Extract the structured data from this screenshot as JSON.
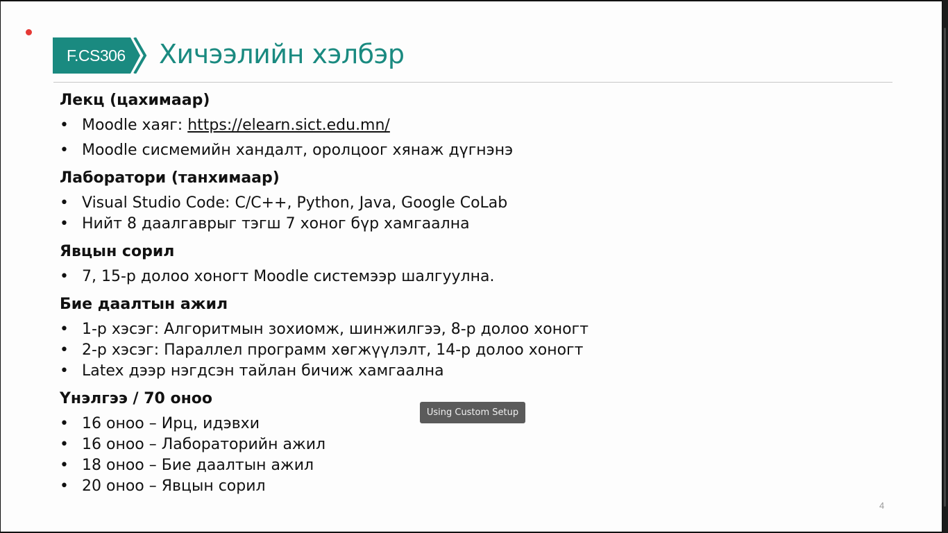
{
  "slide": {
    "course_code": "F.CS306",
    "title": "Хичээлийн хэлбэр",
    "page_number": "4",
    "accent_color": "#1a8a80"
  },
  "sections": [
    {
      "heading": "Лекц (цахимаар)",
      "items": [
        {
          "prefix": "Moodle хаяг: ",
          "link": "https://elearn.sict.edu.mn/"
        },
        {
          "text": "Moodle сисмемийн хандалт, оролцоог хянаж дүгнэнэ"
        }
      ]
    },
    {
      "heading": "Лаборатори (танхимаар)",
      "items": [
        {
          "text": "Visual Studio Code: C/C++, Python, Java, Google CoLab"
        },
        {
          "text": "Нийт 8 даалгаврыг тэгш 7 хоног бүр хамгаална"
        }
      ]
    },
    {
      "heading": "Явцын сорил",
      "items": [
        {
          "text": "7, 15-р долоо хоногт Moodle системээр шалгуулна."
        }
      ]
    },
    {
      "heading": "Бие даалтын ажил",
      "items": [
        {
          "text": "1-р хэсэг: Алгоритмын зохиомж, шинжилгээ, 8-р долоо хоногт"
        },
        {
          "text": "2-р хэсэг: Параллел программ хөгжүүлэлт, 14-р долоо хоногт"
        },
        {
          "text": "Latex дээр нэгдсэн тайлан бичиж хамгаална"
        }
      ]
    },
    {
      "heading": "Үнэлгээ / 70 оноо",
      "items": [
        {
          "text": "16 оноо – Ирц, идэвхи"
        },
        {
          "text": "16 оноо – Лабораторийн ажил"
        },
        {
          "text": "18 оноо – Бие даалтын ажил"
        },
        {
          "text": "20 оноо – Явцын сорил"
        }
      ]
    }
  ],
  "bullet_char": "•",
  "tooltip": {
    "text": "Using Custom Setup"
  }
}
